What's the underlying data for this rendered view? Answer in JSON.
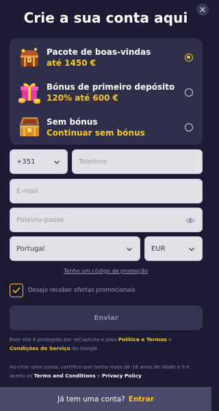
{
  "header": {
    "title": "Crie a sua conta aqui",
    "close_icon": "close-icon"
  },
  "bonuses": [
    {
      "title": "Pacote de boas-vindas",
      "subtitle": "até 1450 €",
      "icon": "treasure-chest-icon",
      "selected": true
    },
    {
      "title": "Bónus de primeiro depósito",
      "subtitle": "120% até 600 €",
      "icon": "gift-coins-icon",
      "selected": false
    },
    {
      "title": "Sem bónus",
      "subtitle": "Continuar sem bónus",
      "icon": "open-chest-icon",
      "selected": false
    }
  ],
  "form": {
    "phone_code": "+351",
    "phone_placeholder": "Telefone",
    "email_placeholder": "E-mail",
    "password_placeholder": "Palavra-passe",
    "country": "Portugal",
    "currency": "EUR",
    "promo_link": "Tenho um código de promoção",
    "offers_label": "Desejo receber ofertas promocionais",
    "offers_checked": true,
    "submit_label": "Enviar"
  },
  "legal": {
    "recaptcha_text": "Este site é protegido por reCaptcha e pela ",
    "policy_terms": "Política e Termos",
    "recaptcha_and": " e ",
    "google_terms": "Condições de Serviço",
    "recaptcha_suffix": " da Google",
    "age_text": "Ao criar uma conta, certifico que tenho mais de 18 anos de idade e li e aceito os ",
    "terms": "Terms and Conditions",
    "age_and": " e ",
    "privacy": "Privacy Policy"
  },
  "footer": {
    "question": "Já tem uma conta?",
    "login_label": "Entrar"
  },
  "colors": {
    "background": "#1c1b33",
    "card": "#2f2e4b",
    "accent": "#f7c623",
    "field": "#e2e1e8",
    "footer": "#4b4a6a"
  }
}
